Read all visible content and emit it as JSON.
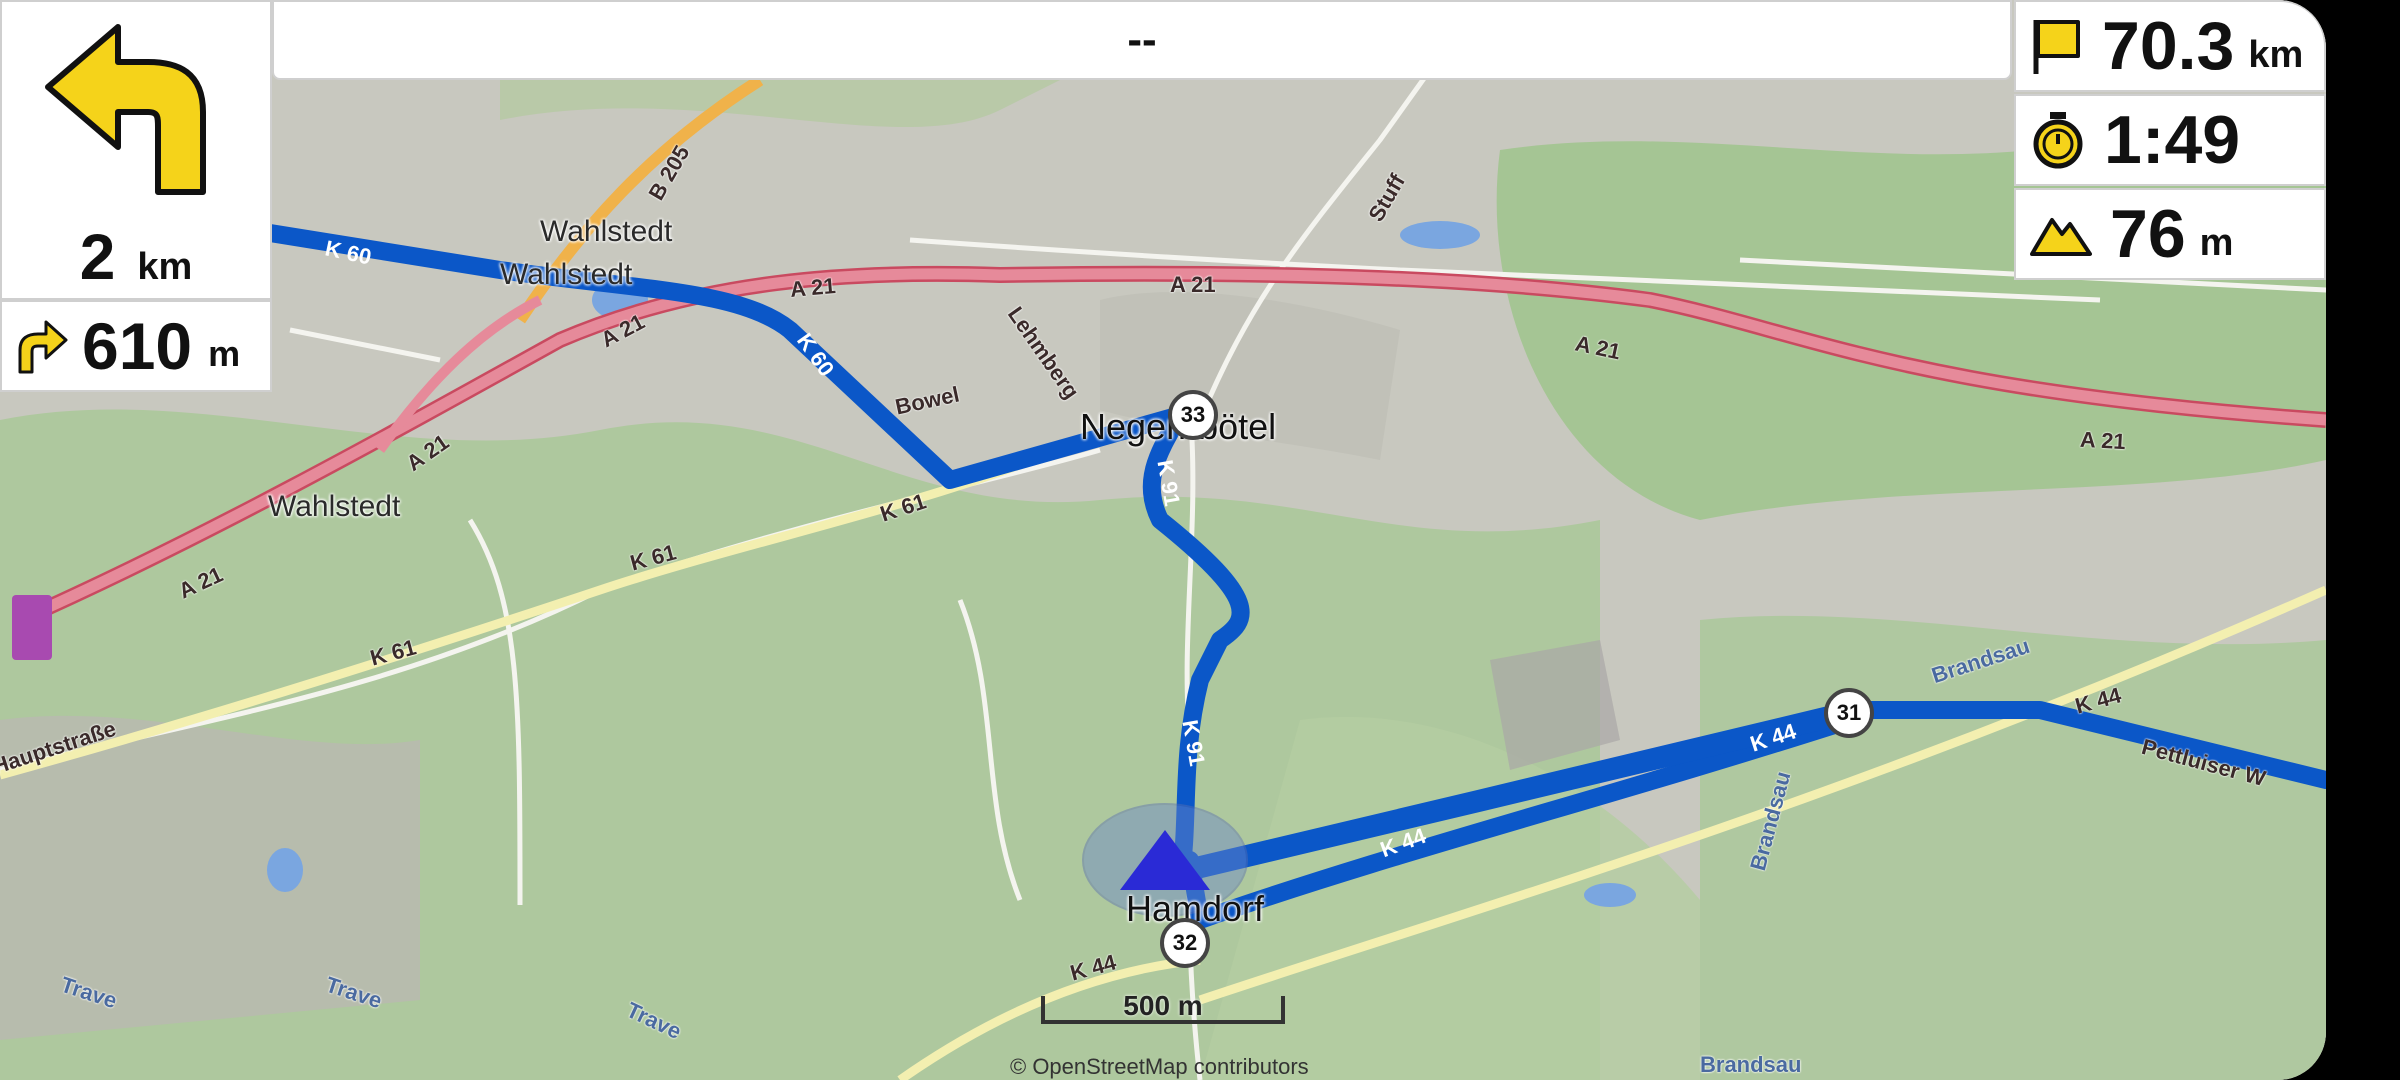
{
  "street_bar": {
    "text": "--"
  },
  "turn_main": {
    "distance_value": "2",
    "distance_unit": "km",
    "icon": "turn-left-arrow-icon"
  },
  "turn_next": {
    "distance_value": "610",
    "distance_unit": "m",
    "icon": "turn-right-arrow-icon"
  },
  "stats": {
    "distance": {
      "value": "70.3",
      "unit": "km",
      "icon": "flag-icon"
    },
    "time": {
      "value": "1:49",
      "icon": "stopwatch-icon"
    },
    "altitude": {
      "value": "76",
      "unit": "m",
      "icon": "mountain-icon"
    }
  },
  "map": {
    "places": [
      "Wahlstedt",
      "Wahlstedt",
      "Wahlstedt",
      "Negernbötel",
      "Hamdorf",
      "Bowel",
      "Lehmberg",
      "Brandsau",
      "Brandsau",
      "Brandsau",
      "Trave",
      "Trave",
      "Trave",
      "Hauptstraße",
      "Pettluiser W"
    ],
    "roads": [
      "A 21",
      "A 21",
      "A 21",
      "A 21",
      "A 21",
      "A 21",
      "K 60",
      "K 60",
      "K 61",
      "K 61",
      "K 61",
      "K 91",
      "K 91",
      "K 44",
      "K 44",
      "K 44",
      "K 44",
      "B 205",
      "Stuff",
      "A 21"
    ],
    "route_shields": [
      "33",
      "31",
      "32"
    ],
    "scale_label": "500 m",
    "attribution": "© OpenStreetMap contributors"
  },
  "colors": {
    "route": "#0b57c8",
    "motorway": "#e07a8c",
    "forest": "#9fc48c",
    "farmland": "#c9c9be",
    "arrow": "#f5d31a",
    "position_marker": "#2a2ad6"
  }
}
